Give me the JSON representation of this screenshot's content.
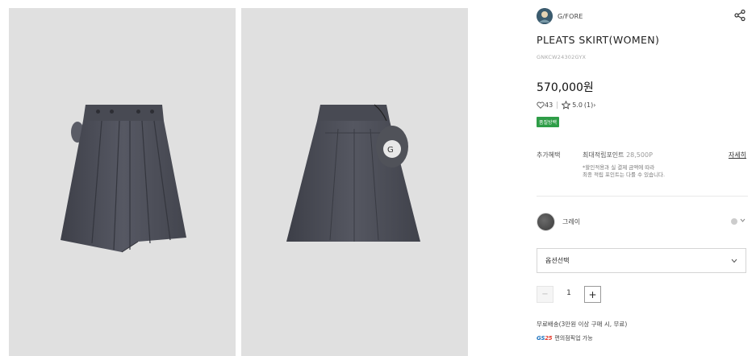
{
  "images": [
    {
      "name": "front-view"
    },
    {
      "name": "back-view"
    }
  ],
  "product": {
    "brand": "G/FORE",
    "title": "PLEATS SKIRT(WOMEN)",
    "code": "GNKCW24302GYX",
    "price": "570,000원",
    "likes": "43",
    "rating": "5.0",
    "reviews": "(1)",
    "review_chevron": "›",
    "badge": "품질방백"
  },
  "benefit": {
    "label": "추가혜택",
    "main": "최대적립포인트",
    "points": "28,500P",
    "more": "자세히",
    "note_line1": "*할인적용과 실 결제 금액에 따라",
    "note_line2": "최종 적립 포인트는 다를 수 있습니다."
  },
  "color": {
    "name": "그레이",
    "hex": "#4a4a4a"
  },
  "option": {
    "placeholder": "옵션선택"
  },
  "quantity": {
    "minus": "−",
    "value": "1",
    "plus": "+"
  },
  "shipping": {
    "text": "무료배송(3만원 이상 구매 시, 무료)",
    "gs_logo_a": "GS",
    "gs_logo_b": "25",
    "gs_text": "편의점픽업 가능"
  },
  "colors": {
    "accent_green": "#2e9d47",
    "skirt_dark": "#4a4d57"
  }
}
